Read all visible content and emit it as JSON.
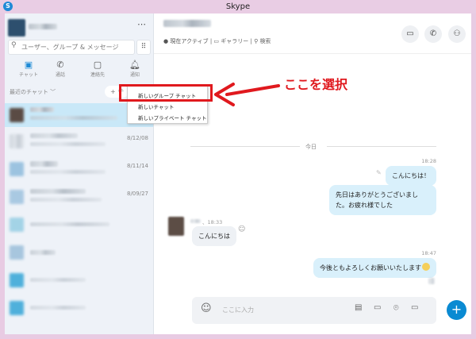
{
  "window": {
    "title": "Skype",
    "logo": "S"
  },
  "sidebar": {
    "more_icon": "more-icon",
    "search_placeholder": "ユーザー、グループ & メッセージ",
    "tabs": [
      {
        "label": "チャット",
        "icon": "chat-icon"
      },
      {
        "label": "通話",
        "icon": "phone-icon"
      },
      {
        "label": "連絡先",
        "icon": "contacts-icon"
      },
      {
        "label": "通知",
        "icon": "bell-icon"
      }
    ],
    "recent_label": "最近のチャット ﹀",
    "new_button": "+ チ",
    "chats": [
      {
        "date": ""
      },
      {
        "date": "8/12/08"
      },
      {
        "date": "8/11/14"
      },
      {
        "date": "8/09/27"
      },
      {
        "date": ""
      },
      {
        "date": ""
      },
      {
        "date": ""
      },
      {
        "date": ""
      }
    ]
  },
  "menu": {
    "items": [
      "新しいグループ チャット",
      "新しいチャット",
      "新しいプライベート チャット"
    ]
  },
  "annotation": {
    "text": "ここを選択",
    "color": "#e0191e"
  },
  "header": {
    "status": "● 現在アクティブ",
    "gallery": "ギャラリー",
    "search": "検索",
    "sep": "|"
  },
  "chat": {
    "date_divider": "今日",
    "messages": [
      {
        "time": "18:28",
        "text": "こんにちは！"
      },
      {
        "text": "先日はありがとうございました。お疲れ様でした"
      },
      {
        "time": "、18:33",
        "text": "こんにちは"
      },
      {
        "time": "18:47",
        "text": "今後ともよろしくお願いいたします"
      }
    ],
    "input_placeholder": "ここに入力"
  },
  "colors": {
    "accent": "#0a8ad2",
    "bubble": "#d9f0fb",
    "selected": "#c9e8f8"
  }
}
